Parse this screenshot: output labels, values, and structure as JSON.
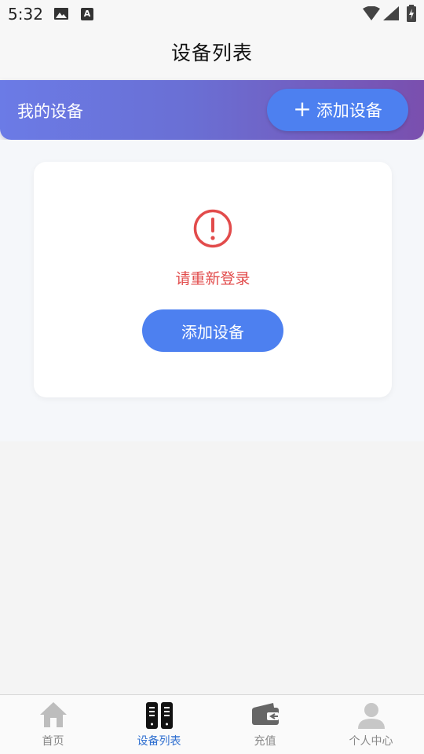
{
  "status_bar": {
    "time": "5:32",
    "icons": [
      "image-icon",
      "a-icon",
      "wifi-icon",
      "cellular-icon",
      "battery-icon"
    ],
    "a_icon_glyph": "A"
  },
  "title_bar": {
    "title": "设备列表"
  },
  "banner": {
    "title": "我的设备",
    "add_button_icon": "+",
    "add_button_label": "添加设备"
  },
  "empty_state": {
    "icon": "alert-circle-icon",
    "message": "请重新登录",
    "button_label": "添加设备"
  },
  "tab_bar": {
    "tabs": [
      {
        "label": "首页",
        "icon": "home-icon",
        "active": false
      },
      {
        "label": "设备列表",
        "icon": "device-list-icon",
        "active": true
      },
      {
        "label": "充值",
        "icon": "wallet-icon",
        "active": false
      },
      {
        "label": "个人中心",
        "icon": "person-icon",
        "active": false
      }
    ]
  },
  "colors": {
    "accent": "#4d80f0",
    "error": "#e24b4b",
    "active_tab": "#2f6fd0",
    "banner_gradient_start": "#6b7be6",
    "banner_gradient_end": "#7a4fae"
  }
}
